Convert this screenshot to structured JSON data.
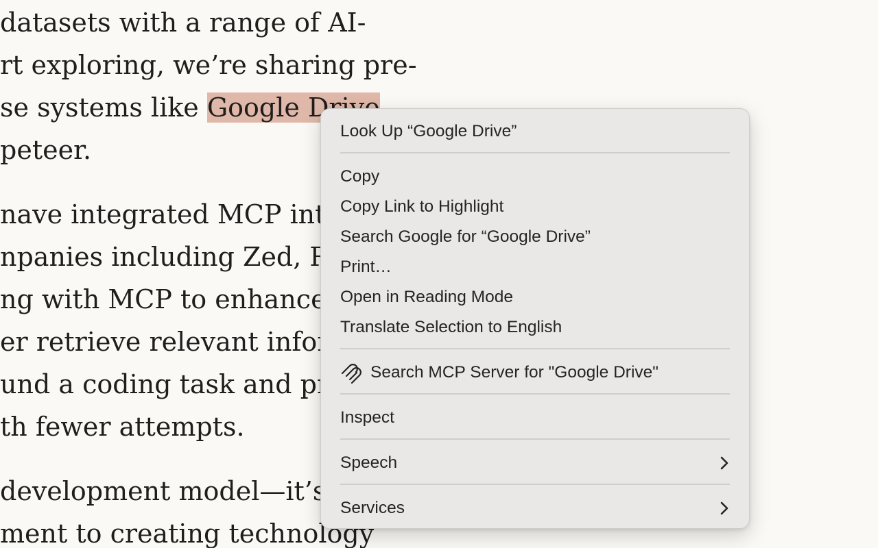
{
  "article": {
    "lines": [
      "datasets with a range of AI-",
      "rt exploring, we’re sharing pre-",
      "se systems like ",
      "peteer.",
      "nave integrated MCP into t",
      "npanies including Zed, Re",
      "ng with MCP to enhance th",
      "er retrieve relevant inform",
      "und a coding task and pro",
      "th fewer attempts.",
      "development model—it’s",
      "ment to creating technology"
    ],
    "highlighted_text": "Google Drive"
  },
  "context_menu": {
    "look_up": "Look Up “Google Drive”",
    "copy": "Copy",
    "copy_link": "Copy Link to Highlight",
    "search_google": "Search Google for “Google Drive”",
    "print": "Print…",
    "reading_mode": "Open in Reading Mode",
    "translate": "Translate Selection to English",
    "search_mcp": "Search MCP Server for \"Google Drive\"",
    "search_mcp_icon": "mcp-logo-icon",
    "inspect": "Inspect",
    "speech": "Speech",
    "services": "Services",
    "submenu_icon": "chevron-right-icon"
  }
}
